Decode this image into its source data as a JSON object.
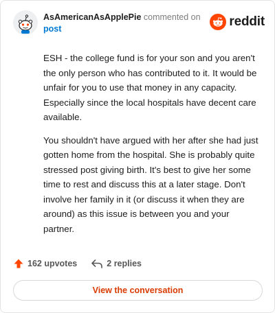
{
  "comment": {
    "author": "AsAmericanAsApplePie",
    "action_text": "commented on",
    "post_link_text": "post",
    "paragraphs": [
      "ESH - the college fund is for your son and you aren't the only person who has contributed to it. It would be unfair for you to use that money in any capacity. Especially since the local hospitals have decent care available.",
      "You shouldn't have argued with her after she had just gotten home from the hospital. She is probably quite stressed post giving birth. It's best to give her some time to rest and discuss this at a later stage. Don't involve her family in it (or discuss it when they are around) as this issue is between you and your partner."
    ]
  },
  "brand": {
    "wordmark": "reddit",
    "logo_icon": "reddit-alien-icon",
    "accent_color": "#ff4500"
  },
  "actions": {
    "upvotes_label": "162 upvotes",
    "replies_label": "2 replies",
    "upvote_icon": "upvote-arrow-icon",
    "reply_icon": "reply-arrow-icon",
    "upvote_color": "#ff4500"
  },
  "footer": {
    "view_conversation_label": "View the conversation",
    "button_text_color": "#d93a00"
  }
}
